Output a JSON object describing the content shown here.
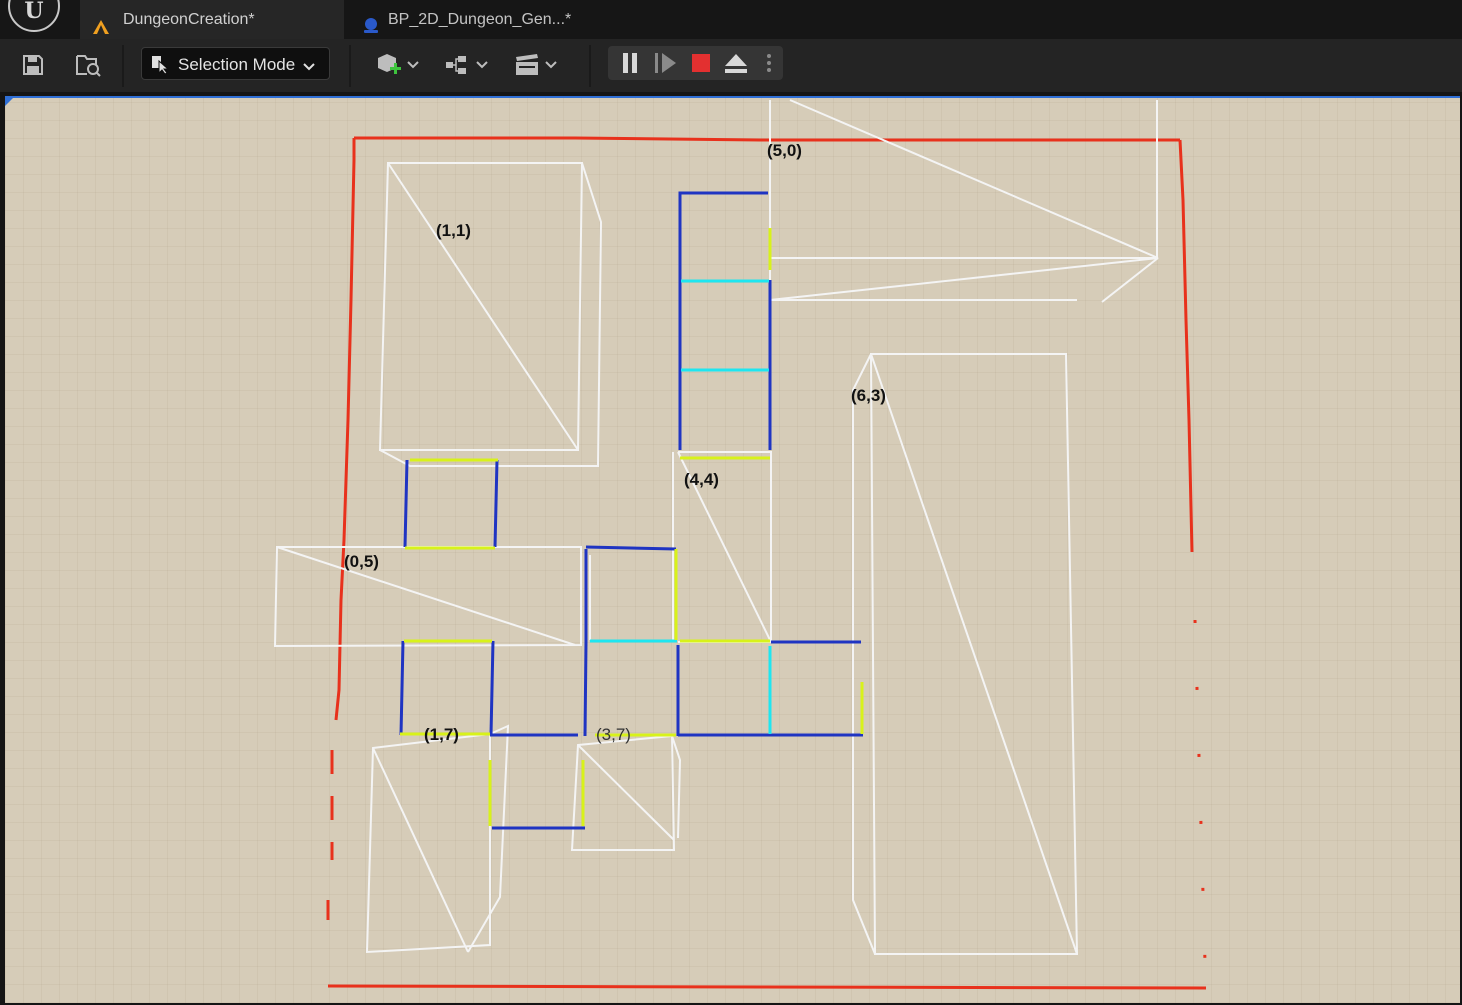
{
  "tabs": [
    {
      "label": "DungeonCreation*",
      "icon": "level-map-icon",
      "active": true
    },
    {
      "label": "BP_2D_Dungeon_Gen...*",
      "icon": "blueprint-icon",
      "active": false
    }
  ],
  "toolbar": {
    "save_icon": "save-icon",
    "browse_icon": "content-browser-icon",
    "selection_mode_label": "Selection Mode",
    "add_icon": "add-actor-icon",
    "blueprint_icon": "blueprint-graph-icon",
    "cinematics_icon": "cinematics-clapper-icon",
    "play_controls": [
      "pause-icon",
      "step-icon",
      "stop-icon",
      "eject-icon",
      "more-options-icon"
    ]
  },
  "viewport": {
    "room_labels": [
      "(1,1)",
      "(5,0)",
      "(4,4)",
      "(6,3)",
      "(0,5)",
      "(1,7)",
      "(3,7)"
    ],
    "colors": {
      "background": "#d6ccb8",
      "boundary": "#e8311c",
      "room_outline": "#f4f4f4",
      "corridor": "#1f34c2",
      "door": "#d8f21a",
      "connector": "#1ee6f0",
      "stop": "#e33030"
    }
  }
}
